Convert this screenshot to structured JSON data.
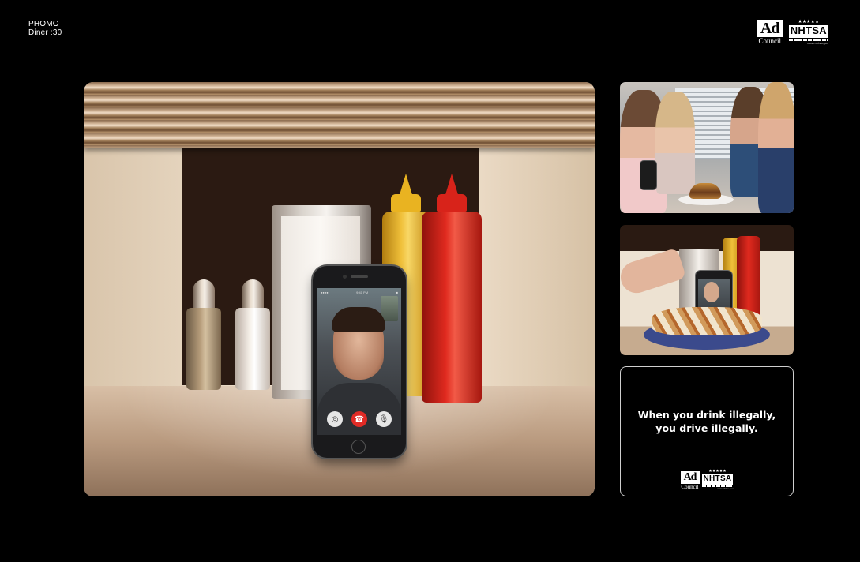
{
  "header": {
    "line1": "PHOMO",
    "line2": "Diner :30"
  },
  "logos": {
    "ad_council_mark": "Ad",
    "ad_council_sub": "Council",
    "nhtsa_stars": "★★★★★",
    "nhtsa_mark": "NHTSA",
    "nhtsa_url": "www.nhtsa.gov"
  },
  "tagline": {
    "line1": "When you drink illegally,",
    "line2": "you drive illegally."
  },
  "phone": {
    "status_left": "●●●● ",
    "status_time": "9:41 PM",
    "status_right": "■",
    "camflip_icon": "◎",
    "end_icon": "☎",
    "mute_icon": "🎙"
  },
  "colors": {
    "background": "#000000",
    "accent_red": "#e12b26",
    "mustard": "#e9b321",
    "ketchup": "#d8231a"
  }
}
